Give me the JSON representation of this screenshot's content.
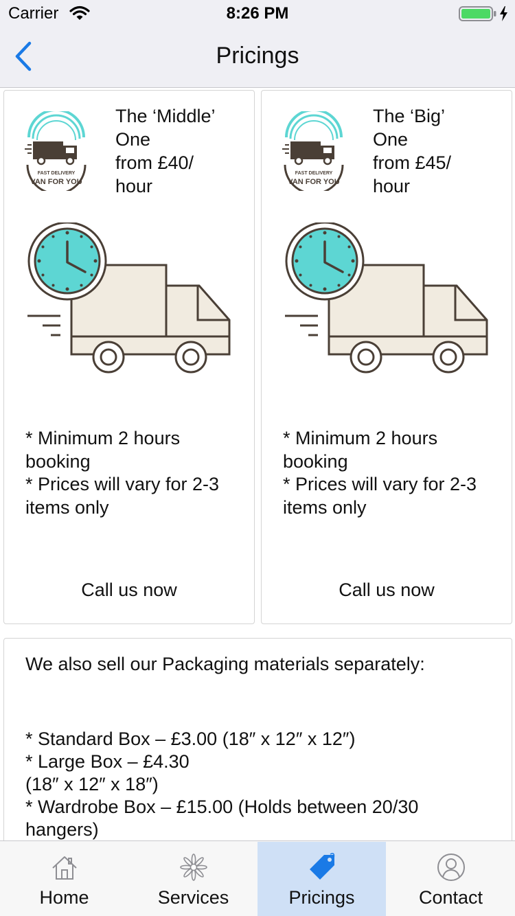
{
  "status_bar": {
    "carrier": "Carrier",
    "time": "8:26 PM"
  },
  "nav": {
    "title": "Pricings",
    "back_icon": "chevron-left-icon"
  },
  "pricing_cards": [
    {
      "title_line1": "The ‘Middle’",
      "title_line2": "One",
      "title_line3": "from £40/",
      "title_line4": "hour",
      "logo_text_top": "FAST DELIVERY",
      "logo_text_bottom": "VAN FOR YOU",
      "notes": " * Minimum 2 hours booking\n * Prices will vary for 2-3 items only",
      "cta": "Call us now"
    },
    {
      "title_line1": "The ‘Big’",
      "title_line2": "One",
      "title_line3": "from £45/",
      "title_line4": "hour",
      "logo_text_top": "FAST DELIVERY",
      "logo_text_bottom": "VAN FOR YOU",
      "notes": " * Minimum 2 hours booking\n * Prices will vary for 2-3 items only",
      "cta": "Call us now"
    }
  ],
  "packaging": {
    "heading": "We also sell our Packaging materials separately:",
    "items": [
      " * Standard Box – £3.00 (18″ x 12″ x 12″)",
      " * Large Box – £4.30\n (18″ x 12″ x 18″)",
      " * Wardrobe Box – £15.00 (Holds between 20/30 hangers)"
    ]
  },
  "tabs": [
    {
      "label": "Home",
      "icon": "home-icon"
    },
    {
      "label": "Services",
      "icon": "flower-icon"
    },
    {
      "label": "Pricings",
      "icon": "price-tag-icon",
      "selected": true
    },
    {
      "label": "Contact",
      "icon": "user-icon"
    }
  ],
  "colors": {
    "accent": "#1a7ae6",
    "tab_selected_bg": "#cfe0f6",
    "clock_face": "#5dd6d3",
    "van_body": "#f1ebe0",
    "line_dark": "#4a3f36",
    "battery": "#4cd964"
  }
}
